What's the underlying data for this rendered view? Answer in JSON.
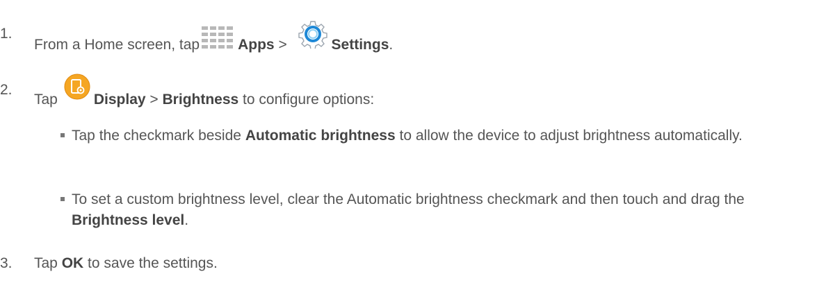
{
  "steps": [
    {
      "number": "1.",
      "text_before": "From a Home screen, tap",
      "apps_label": "Apps",
      "separator": ">",
      "settings_label": "Settings",
      "end_punct": "."
    },
    {
      "number": "2.",
      "text_before": "Tap",
      "display_label": "Display",
      "separator": ">",
      "brightness_label": "Brightness",
      "text_after": "to configure options:",
      "bullets": [
        {
          "text_before": "Tap the checkmark beside",
          "bold": "Automatic brightness",
          "text_after": "to allow the device to adjust brightness automatically."
        },
        {
          "text_before": "To set a custom brightness level, clear the Automatic brightness checkmark and then touch and drag the",
          "bold": "Brightness level",
          "text_after": "."
        }
      ]
    },
    {
      "number": "3.",
      "text_before": "Tap",
      "ok_label": "OK",
      "text_after": "to save the settings."
    }
  ],
  "icons": {
    "apps": "apps-grid-icon",
    "settings": "settings-gear-icon",
    "display": "display-settings-icon"
  },
  "colors": {
    "text": "#555555",
    "display_icon": "#f0a428",
    "gear_icon": "#3aa3e3"
  }
}
